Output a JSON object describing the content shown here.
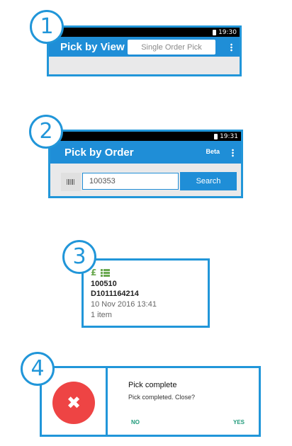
{
  "badges": [
    "1",
    "2",
    "3",
    "4"
  ],
  "panel1": {
    "time": "19:30",
    "title": "Pick by View",
    "mode_button": "Single Order Pick",
    "menu_icon": "more-vert-icon"
  },
  "panel2": {
    "time": "19:31",
    "title": "Pick by Order",
    "beta": "Beta",
    "scan_icon": "barcode-icon",
    "order_input": "100353",
    "search_button": "Search"
  },
  "panel3": {
    "currency_icon": "pound-icon",
    "list_icon": "list-icon",
    "order_number": "100510",
    "reference": "D1011164214",
    "datetime": "10 Nov 2016 13:41",
    "items": "1 item",
    "icon_color": "#6aa84f"
  },
  "panel4": {
    "error_icon": "close-icon",
    "title": "Pick complete",
    "message": "Pick completed. Close?",
    "no_label": "NO",
    "yes_label": "YES",
    "accent": "#1f9a7a",
    "error_color": "#ee4444"
  },
  "colors": {
    "accent": "#2196d9",
    "appbar": "#1f8ed7"
  }
}
